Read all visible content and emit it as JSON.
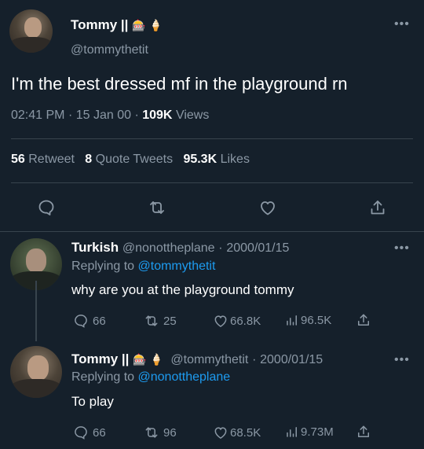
{
  "main_tweet": {
    "author_name": "Tommy ||",
    "author_emoji": "🎰 🍦",
    "handle": "@tommythetit",
    "more": "•••",
    "text": "I'm the best dressed mf in the playground rn",
    "time": "02:41 PM",
    "date": "15 Jan 00",
    "views_count": "109K",
    "views_label": "Views",
    "sep": "·",
    "retweets_count": "56",
    "retweets_label": "Retweet",
    "quotes_count": "8",
    "quotes_label": "Quote Tweets",
    "likes_count": "95.3K",
    "likes_label": "Likes"
  },
  "replies": [
    {
      "author_name": "Turkish",
      "handle": "@nonottheplane",
      "sep": "·",
      "date": "2000/01/15",
      "replying_label": "Replying to",
      "replying_to": "@tommythetit",
      "text": "why are you at the playground tommy",
      "more": "•••",
      "reply_count": "66",
      "retweet_count": "25",
      "like_count": "66.8K",
      "views_count": "96.5K"
    },
    {
      "author_name": "Tommy ||",
      "author_emoji": "🎰 🍦",
      "handle": "@tommythetit",
      "sep": "·",
      "date": "2000/01/15",
      "replying_label": "Replying to",
      "replying_to": "@nonottheplane",
      "text": "To play",
      "more": "•••",
      "reply_count": "66",
      "retweet_count": "96",
      "like_count": "68.5K",
      "views_count": "9.73M"
    }
  ],
  "colors": {
    "background": "#15202b",
    "muted": "#8b98a5",
    "link": "#1d9bf0",
    "divider": "#38444d"
  }
}
